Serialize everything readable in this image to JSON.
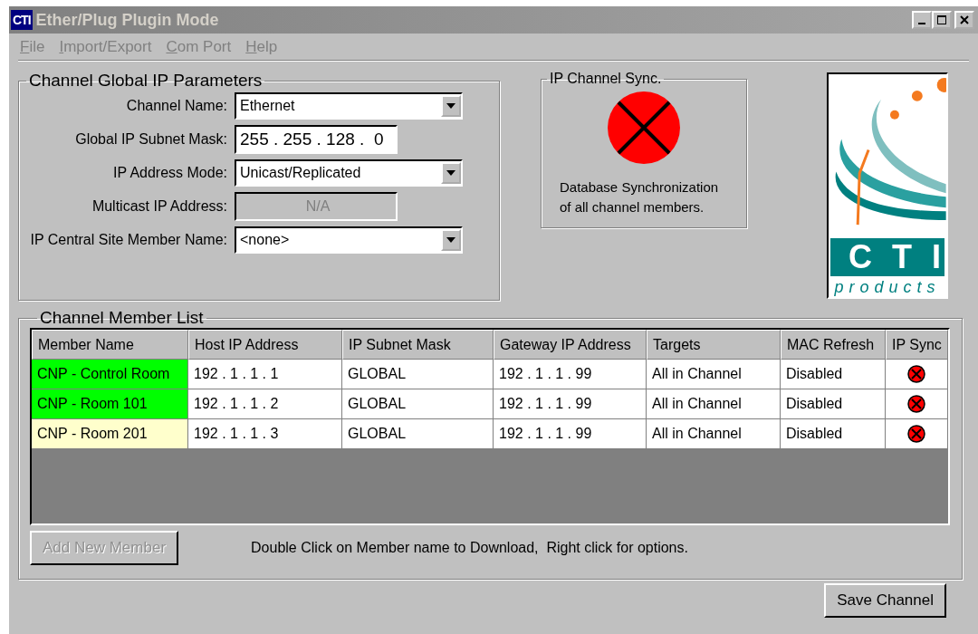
{
  "window": {
    "icon_text": "CTI",
    "title": "Ether/Plug Plugin Mode",
    "active": false
  },
  "menu": [
    {
      "label": "File"
    },
    {
      "label": "Import/Export"
    },
    {
      "label": "Com Port"
    },
    {
      "label": "Help"
    }
  ],
  "global_params": {
    "title": "Channel Global IP Parameters",
    "fields": [
      {
        "kind": "select",
        "label": "Channel Name:",
        "value": "Ethernet"
      },
      {
        "kind": "ip",
        "label": "Global IP Subnet Mask:",
        "value": "255 . 255 . 128 .  0",
        "disabled": false
      },
      {
        "kind": "select",
        "label": "IP Address Mode:",
        "value": "Unicast/Replicated"
      },
      {
        "kind": "ip",
        "label": "Multicast IP Address:",
        "value": "N/A",
        "disabled": true
      },
      {
        "kind": "select",
        "label": "IP Central Site Member Name:",
        "value": "<none>"
      }
    ]
  },
  "sync": {
    "title": "IP Channel Sync.",
    "synced": false,
    "description": "Database Synchronization of all channel members."
  },
  "logo": {
    "word": "CTI",
    "tagline": "products"
  },
  "member_list": {
    "title": "Channel Member List",
    "columns": [
      "Member Name",
      "Host IP Address",
      "IP Subnet Mask",
      "Gateway IP Address",
      "Targets",
      "MAC Refresh",
      "IP Sync"
    ],
    "rows": [
      {
        "name": "CNP - Control Room",
        "color": "#00ff00",
        "host": "192 . 1 . 1 . 1",
        "mask": "GLOBAL",
        "gateway": "192 . 1 . 1 . 99",
        "targets": "All in Channel",
        "mac_refresh": "Disabled",
        "synced": false
      },
      {
        "name": "CNP - Room 101",
        "color": "#00ff00",
        "host": "192 . 1 . 1 . 2",
        "mask": "GLOBAL",
        "gateway": "192 . 1 . 1 . 99",
        "targets": "All in Channel",
        "mac_refresh": "Disabled",
        "synced": false
      },
      {
        "name": "CNP - Room 201",
        "color": "#ffffcc",
        "host": "192 . 1 . 1 . 3",
        "mask": "GLOBAL",
        "gateway": "192 . 1 . 1 . 99",
        "targets": "All in Channel",
        "mac_refresh": "Disabled",
        "synced": false
      }
    ],
    "add_button": {
      "label": "Add New Member",
      "disabled": true
    },
    "hint": "Double Click on Member name to Download,  Right click for options."
  },
  "save_button": {
    "label": "Save Channel",
    "disabled": false
  }
}
